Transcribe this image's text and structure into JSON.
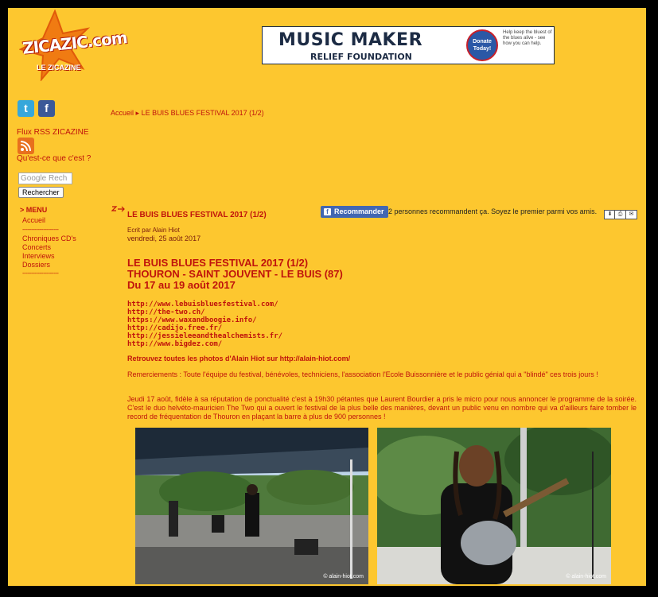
{
  "logo": {
    "main": "ZICAZIC.com",
    "sub": "LE ZICAZINE"
  },
  "banner": {
    "title": "MUSIC MAKER",
    "subtitle": "RELIEF FOUNDATION",
    "badge": "Donate Today!",
    "side": "Help keep the bluest of the blues alive - see how you can help."
  },
  "sidebar": {
    "twitter": "t",
    "facebook": "f",
    "rss_title": "Flux RSS ZICAZINE",
    "rss_what": "Qu'est-ce que c'est ?",
    "google_placeholder": "Google Rech",
    "search_label": "Rechercher",
    "menu_title": "> MENU",
    "items": [
      "Accueil",
      "Chroniques CD's",
      "Concerts",
      "Interviews",
      "Dossiers"
    ],
    "separator": "---------------------"
  },
  "breadcrumb": {
    "home": "Accueil",
    "sep": "▸",
    "current": "LE BUIS BLUES FESTIVAL 2017 (1/2)"
  },
  "article": {
    "title": "LE BUIS BLUES FESTIVAL 2017 (1/2)",
    "recommend_label": "Recommander",
    "recommend_text": "2 personnes recommandent ça. Soyez le premier parmi vos amis.",
    "author": "Ecrit par Alain Hiot",
    "date": "vendredi, 25 août 2017",
    "heading_line1": "LE BUIS BLUES FESTIVAL 2017 (1/2)",
    "heading_line2": "THOURON - SAINT JOUVENT - LE BUIS (87)",
    "heading_line3": "Du 17 au 19 août 2017",
    "links": [
      "http://www.lebuisbluesfestival.com/",
      "http://the-two.ch/",
      "https://www.waxandboogie.info/",
      "http://cadijo.free.fr/",
      "http://jessieleeandthealchemists.fr/",
      "http://www.bigdez.com/"
    ],
    "photos_link": "Retrouvez toutes les photos d'Alain Hiot sur http://alain-hiot.com/",
    "para1": "Remerciements : Toute l'équipe du festival, bénévoles, techniciens, l'association l'Ecole Buissonnière et le public génial qui a \"blindé\" ces trois jours !",
    "para2": "Jeudi 17 août, fidèle à sa réputation de ponctualité c'est à 19h30 pétantes que Laurent Bourdier a pris le micro pour nous annoncer le programme de la soirée. C'est le duo helvéto-mauricien The Two qui a ouvert le festival de la plus belle des manières, devant un public venu en nombre qui va d'ailleurs faire tomber le record de fréquentation de Thouron en plaçant la barre à plus de 900 personnes !",
    "photo_credit": "© alain-hiot.com"
  },
  "colors": {
    "background": "#fdc72f",
    "link_red": "#c0130c",
    "dark_red": "#7a1a0c"
  }
}
